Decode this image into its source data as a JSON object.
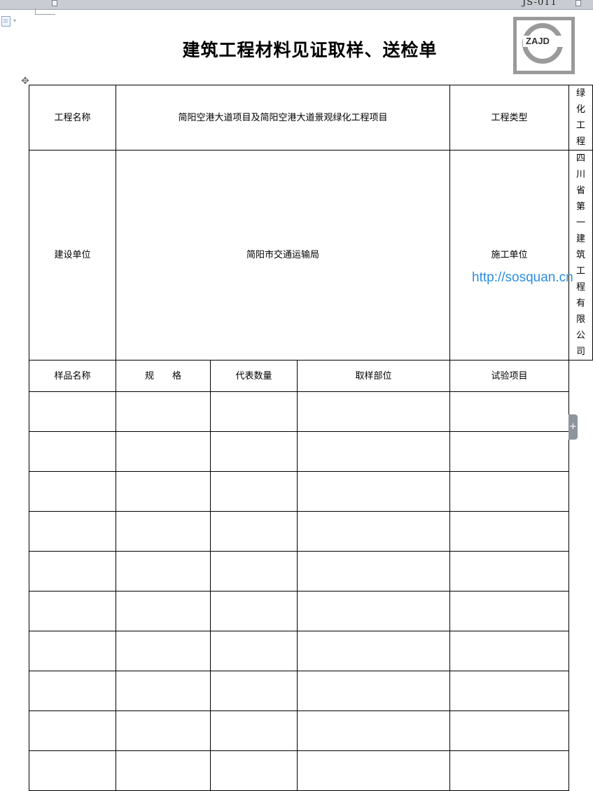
{
  "document": {
    "code": "JS-011",
    "title": "建筑工程材料见证取样、送检单"
  },
  "logo": {
    "text": "ZAJD"
  },
  "info": {
    "project_name_label": "工程名称",
    "project_name_value": "简阳空港大道项目及简阳空港大道景观绿化工程项目",
    "project_type_label": "工程类型",
    "project_type_value": "绿化工程",
    "builder_label": "建设单位",
    "builder_value": "简阳市交通运输局",
    "contractor_label": "施工单位",
    "contractor_value": "四川省第一建筑工程有限公司"
  },
  "columns": [
    "样品名称",
    "规　　格",
    "代表数量",
    "取样部位",
    "试验项目"
  ],
  "rows": [
    [
      "",
      "",
      "",
      "",
      ""
    ],
    [
      "",
      "",
      "",
      "",
      ""
    ],
    [
      "",
      "",
      "",
      "",
      ""
    ],
    [
      "",
      "",
      "",
      "",
      ""
    ],
    [
      "",
      "",
      "",
      "",
      ""
    ],
    [
      "",
      "",
      "",
      "",
      ""
    ],
    [
      "",
      "",
      "",
      "",
      ""
    ],
    [
      "",
      "",
      "",
      "",
      ""
    ],
    [
      "",
      "",
      "",
      "",
      ""
    ],
    [
      "",
      "",
      "",
      "",
      ""
    ]
  ],
  "watermark": "http://sosquan.cn",
  "side_tab": {
    "label": "+"
  },
  "move_handle": {
    "glyph": "✥"
  }
}
